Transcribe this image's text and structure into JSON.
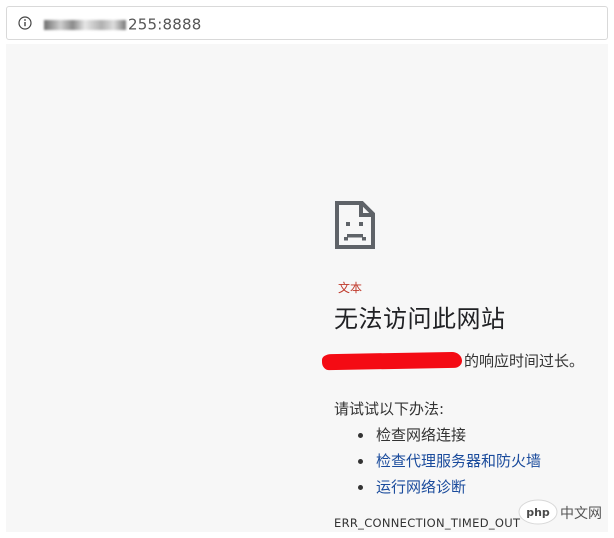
{
  "address_bar": {
    "url_host_visible": "255:8888",
    "icon": "info-icon"
  },
  "error_page": {
    "icon": "broken-document-icon",
    "tag": "文本",
    "title": "无法访问此网站",
    "description_suffix": "的响应时间过长。",
    "try_label": "请试试以下办法:",
    "suggestions": [
      {
        "label": "检查网络连接",
        "is_link": false
      },
      {
        "label": "检查代理服务器和防火墙",
        "is_link": true
      },
      {
        "label": "运行网络诊断",
        "is_link": true
      }
    ],
    "error_code": "ERR_CONNECTION_TIMED_OUT"
  },
  "watermark": {
    "logo_text": "php",
    "site_text": "中文网"
  },
  "colors": {
    "content_bg": "#f7f7f7",
    "link": "#1a4b9c",
    "tag": "#c0392b",
    "redaction": "#f40b14"
  }
}
